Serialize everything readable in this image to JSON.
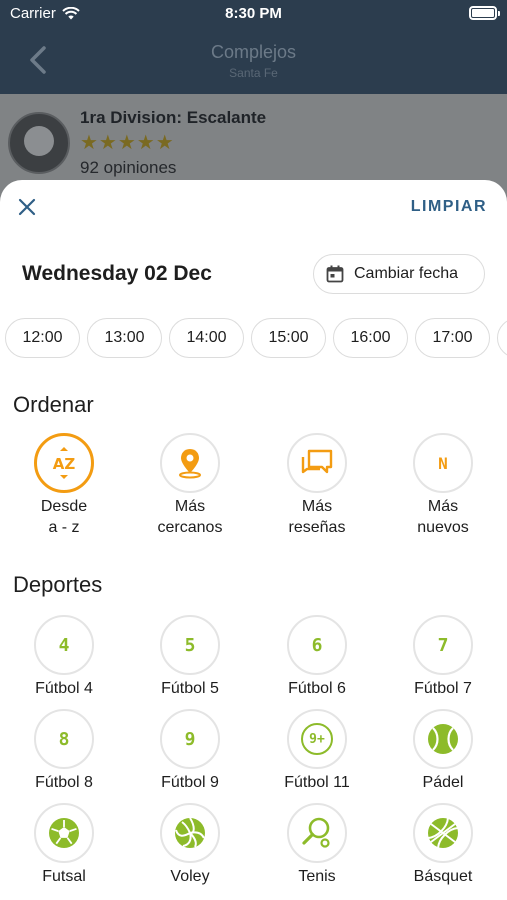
{
  "status_bar": {
    "carrier": "Carrier",
    "time": "8:30 PM"
  },
  "nav": {
    "title": "Complejos",
    "subtitle": "Santa Fe"
  },
  "background_listing": {
    "name": "1ra Division: Escalante",
    "stars": "★★★★★",
    "reviews": "92 opiniones"
  },
  "sheet": {
    "clear_label": "LIMPIAR",
    "date_title": "Wednesday 02 Dec",
    "change_date_label": "Cambiar fecha",
    "times": [
      "12:00",
      "13:00",
      "14:00",
      "15:00",
      "16:00",
      "17:00",
      ""
    ],
    "sort_title": "Ordenar",
    "sort_options": [
      {
        "label": "Desde a - z",
        "icon": "az-sort-icon",
        "active": true,
        "icon_text": "AZ"
      },
      {
        "label": "Más cercanos",
        "icon": "location-pin-icon",
        "active": false
      },
      {
        "label": "Más reseñas",
        "icon": "reviews-chat-icon",
        "active": false
      },
      {
        "label": "Más nuevos",
        "icon": "new-icon",
        "active": false,
        "icon_text": "N"
      }
    ],
    "sports_title": "Deportes",
    "sports": [
      {
        "label": "Fútbol 4",
        "icon_text": "4"
      },
      {
        "label": "Fútbol 5",
        "icon_text": "5"
      },
      {
        "label": "Fútbol 6",
        "icon_text": "6"
      },
      {
        "label": "Fútbol 7",
        "icon_text": "7"
      },
      {
        "label": "Fútbol 8",
        "icon_text": "8"
      },
      {
        "label": "Fútbol 9",
        "icon_text": "9"
      },
      {
        "label": "Fútbol 11",
        "icon_text": "9+"
      },
      {
        "label": "Pádel",
        "icon": "padel-ball-icon"
      },
      {
        "label": "Futsal",
        "icon": "soccer-ball-icon"
      },
      {
        "label": "Voley",
        "icon": "volleyball-icon"
      },
      {
        "label": "Tenis",
        "icon": "tennis-racket-icon"
      },
      {
        "label": "Básquet",
        "icon": "basketball-icon"
      }
    ]
  },
  "colors": {
    "accent_orange": "#f39c12",
    "sport_green": "#8dbb2a",
    "nav_blue": "#2c3d4e",
    "link_blue": "#2f5f86"
  }
}
